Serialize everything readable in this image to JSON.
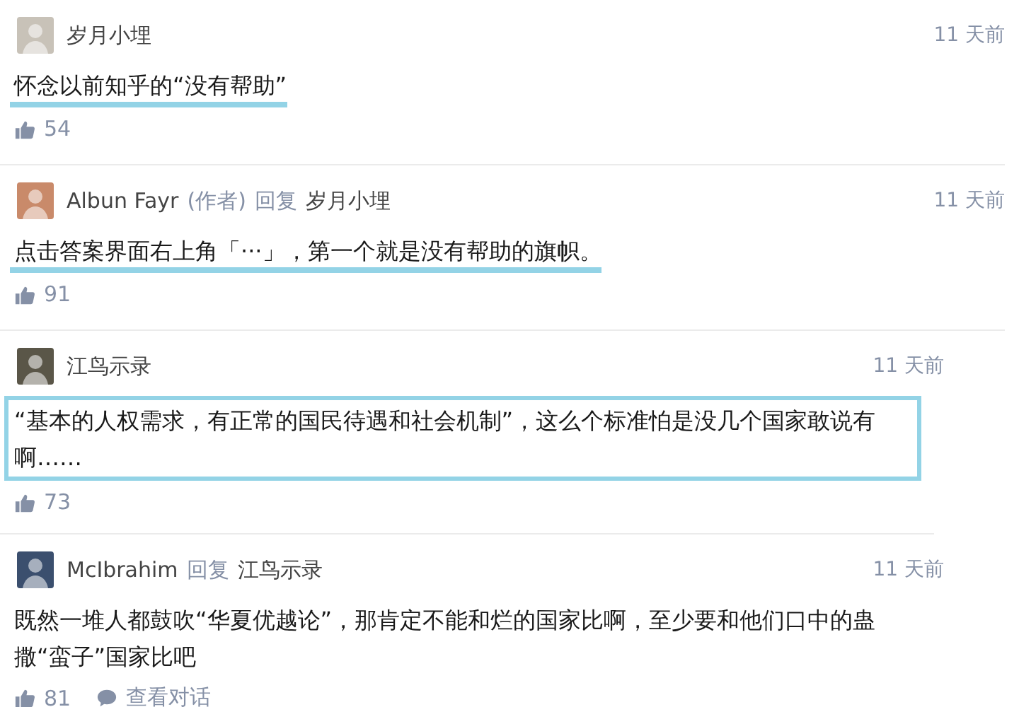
{
  "comments": [
    {
      "author": "岁月小埋",
      "time": "11 天前",
      "text": "怀念以前知乎的“没有帮助”",
      "kind": "underlined",
      "likes": "54",
      "wide": true
    },
    {
      "author": "Albun Fayr",
      "author_tag": "(作者)",
      "reply_word": "回复",
      "reply_to": "岁月小埋",
      "time": "11 天前",
      "text": "点击答案界面右上角「···」，第一个就是没有帮助的旗帜。",
      "kind": "underlined",
      "likes": "91",
      "wide": true
    },
    {
      "author": "江鸟示录",
      "time": "11 天前",
      "text": "“基本的人权需求，有正常的国民待遇和社会机制”，这么个标准怕是没几个国家敢说有啊……",
      "kind": "boxed",
      "likes": "73",
      "wide": false
    },
    {
      "author": "McIbrahim",
      "reply_word": "回复",
      "reply_to": "江鸟示录",
      "time": "11 天前",
      "text": "既然一堆人都鼓吹“华夏优越论”，那肯定不能和烂的国家比啊，至少要和他们口中的蛊撒“蛮子”国家比吧",
      "kind": "plain",
      "likes": "81",
      "wide": false,
      "extra": "查看对话"
    }
  ]
}
